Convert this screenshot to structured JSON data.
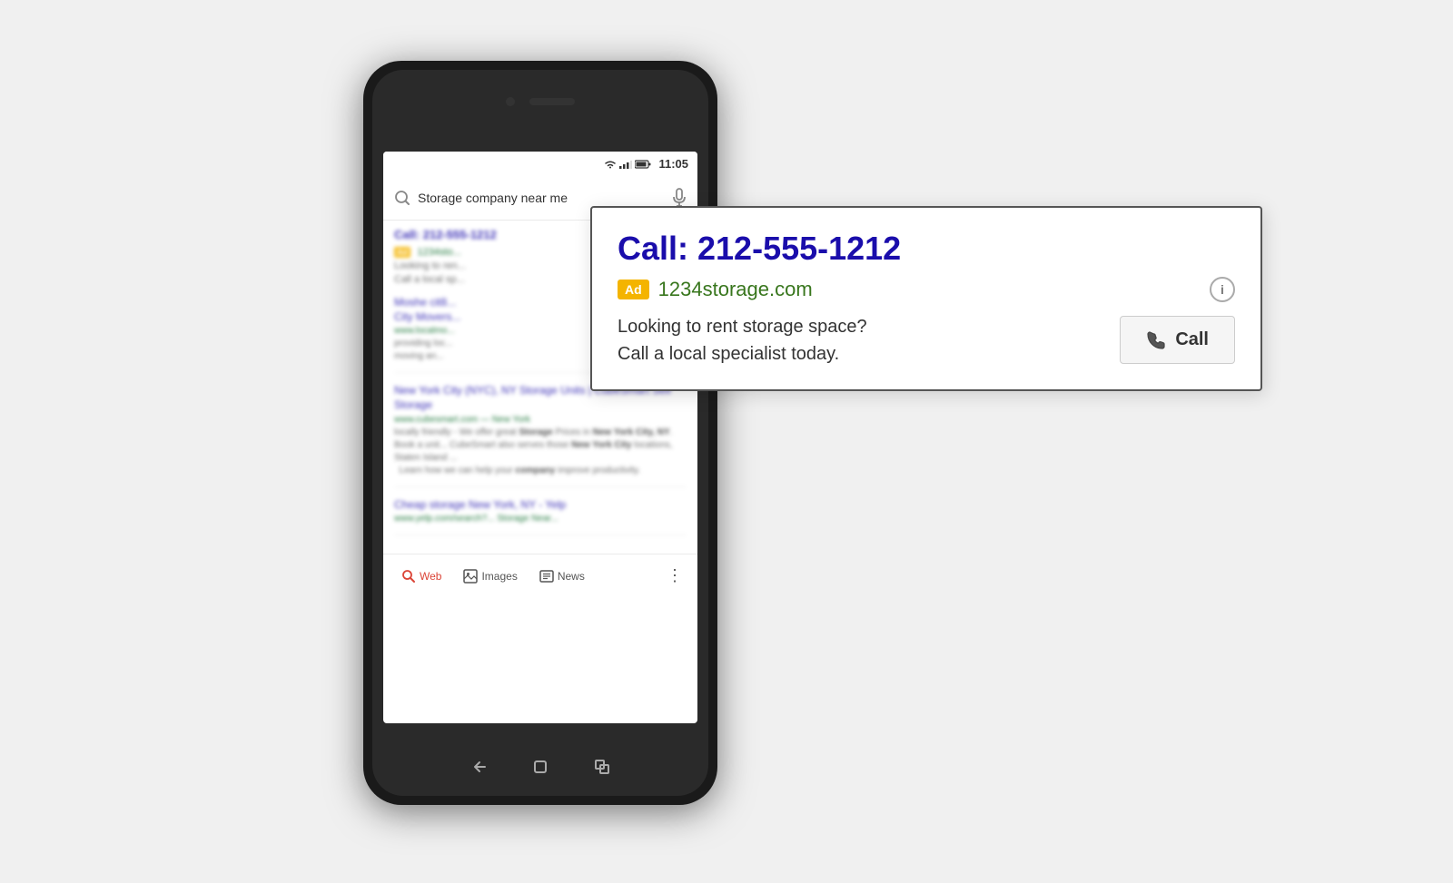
{
  "background": "#f0f0f0",
  "phone": {
    "status_bar": {
      "time": "11:05",
      "icons": [
        "wifi",
        "signal",
        "battery"
      ]
    },
    "search": {
      "placeholder": "Storage company near me",
      "query": "Storage company near me"
    },
    "results": {
      "ad": {
        "call_label": "Call: 212-555-1212",
        "badge": "Ad",
        "url_short": "1234sto...",
        "desc_short": "Looking to ren...\nCall a local sp..."
      },
      "organic_1": {
        "title": "Moshe cit8 ...\nCity Movers...",
        "url": "www.localmo...",
        "desc": "providing loc...\nmoving an..."
      },
      "organic_2": {
        "title": "New York City (NYC), NY Storage Units |\nCubeSmart Self Storage",
        "url": "www.cubesmart.com — New York",
        "desc": "locally friendly - We offer great Storage Prices in New York City, NY. Book a unit... CubeSmart also serves those New York City locations, Staten Island ... Learn how we can help your company improve productivity."
      },
      "organic_3": {
        "title": "Cheap storage New York, NY - Yelp",
        "url": "www.yelp.com/search?... Storage Near..."
      }
    },
    "bottom_tabs": {
      "web": "Web",
      "images": "Images",
      "news": "News"
    }
  },
  "ad_card": {
    "phone": "Call: 212-555-1212",
    "badge": "Ad",
    "url": "1234storage.com",
    "info_label": "i",
    "description_line1": "Looking to rent storage space?",
    "description_line2": "Call a local specialist today.",
    "call_button_label": "Call",
    "call_icon": "📞"
  }
}
